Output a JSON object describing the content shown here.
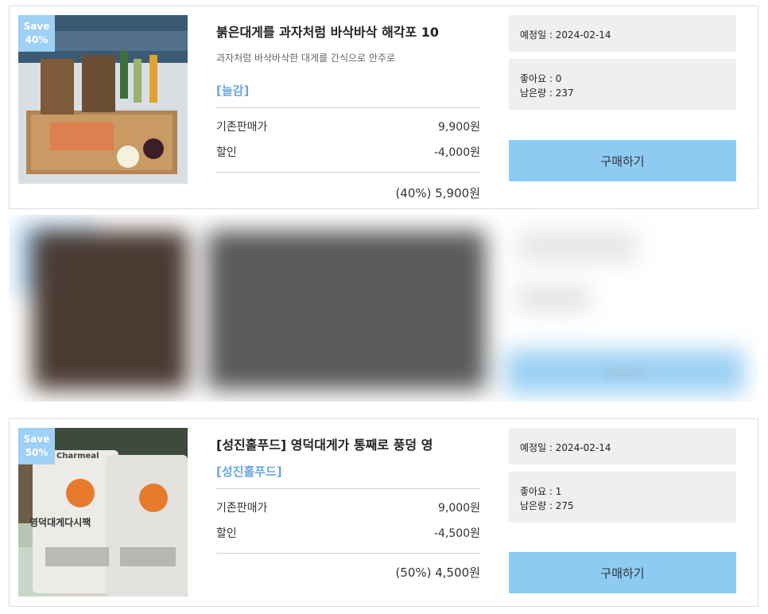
{
  "products": [
    {
      "badge_line1": "Save",
      "badge_line2": "40%",
      "title": "붉은대게를 과자처럼 바삭바삭 해각포 10",
      "subtitle": "과자처럼 바삭바삭한 대게를 간식으로 안주로",
      "brand": "[늘감]",
      "orig_label": "기존판매가",
      "orig_price": "9,900원",
      "disc_label": "할인",
      "disc_price": "-4,000원",
      "final": "(40%) 5,900원",
      "release": "예정일 : 2024-02-14",
      "likes": "좋아요 : 0",
      "stock": "남은량 : 237",
      "buy_label": "구매하기"
    },
    {
      "buy_label": "구매하기"
    },
    {
      "badge_line1": "Save",
      "badge_line2": "50%",
      "title": "[성진홀푸드] 영덕대게가 통째로 풍덩 영",
      "brand": "[성진홀푸드]",
      "orig_label": "기존판매가",
      "orig_price": "9,000원",
      "disc_label": "할인",
      "disc_price": "-4,500원",
      "final": "(50%) 4,500원",
      "release": "예정일 : 2024-02-14",
      "likes": "좋아요 : 1",
      "stock": "남은량 : 275",
      "buy_label": "구매하기",
      "pack_logo": "Charmeal",
      "pack_text": "영덕대게다시팩"
    }
  ],
  "colors": {
    "badge": "#9fd0f6",
    "buy": "#8ecbf3",
    "brand": "#6aa6e0",
    "box": "#efefef"
  }
}
